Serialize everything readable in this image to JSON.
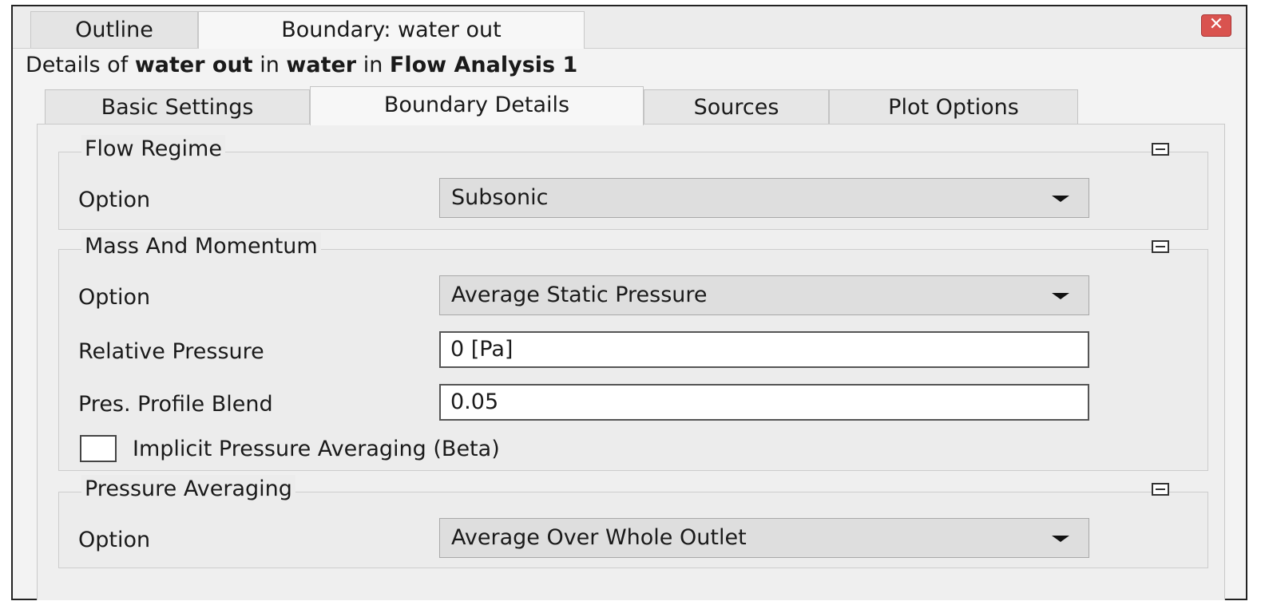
{
  "window": {
    "tabs": [
      "Outline",
      "Boundary: water out"
    ],
    "close_label": "✕"
  },
  "details": {
    "prefix": "Details of",
    "object": "water out",
    "in1": "in",
    "domain": "water",
    "in2": "in",
    "analysis": "Flow Analysis 1"
  },
  "tabs": [
    "Basic Settings",
    "Boundary Details",
    "Sources",
    "Plot Options"
  ],
  "active_tab": "Boundary Details",
  "flow_regime": {
    "title": "Flow Regime",
    "option_label": "Option",
    "option_value": "Subsonic"
  },
  "mass_momentum": {
    "title": "Mass And Momentum",
    "option_label": "Option",
    "option_value": "Average Static Pressure",
    "rel_pressure_label": "Relative Pressure",
    "rel_pressure_value": "0 [Pa]",
    "blend_label": "Pres. Profile Blend",
    "blend_value": "0.05",
    "implicit_label": "Implicit Pressure Averaging (Beta)",
    "implicit_checked": false
  },
  "pressure_averaging": {
    "title": "Pressure Averaging",
    "option_label": "Option",
    "option_value": "Average Over Whole Outlet"
  }
}
